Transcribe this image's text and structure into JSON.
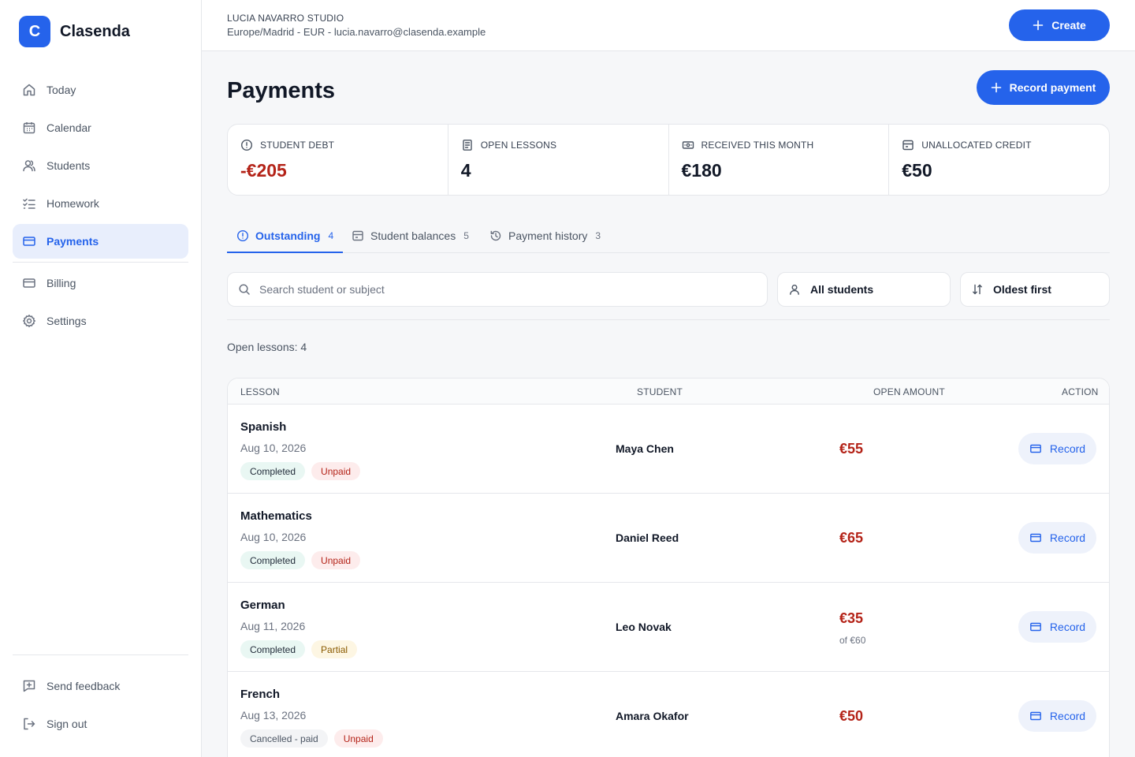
{
  "brand": {
    "logo_letter": "C",
    "name": "Clasenda",
    "accent": "#2563eb"
  },
  "sidebar": {
    "items": [
      {
        "label": "Today",
        "icon": "home-icon"
      },
      {
        "label": "Calendar",
        "icon": "calendar-icon"
      },
      {
        "label": "Students",
        "icon": "users-icon"
      },
      {
        "label": "Homework",
        "icon": "checklist-icon"
      },
      {
        "label": "Payments",
        "icon": "card-icon",
        "active": true
      },
      {
        "label": "Billing",
        "icon": "card-icon"
      },
      {
        "label": "Settings",
        "icon": "gear-icon"
      }
    ],
    "footer": [
      {
        "label": "Send feedback",
        "icon": "feedback-icon"
      },
      {
        "label": "Sign out",
        "icon": "sign-out-icon"
      }
    ]
  },
  "topbar": {
    "studio_name": "LUCIA NAVARRO STUDIO",
    "studio_meta": "Europe/Madrid - EUR - lucia.navarro@clasenda.example",
    "create_label": "Create"
  },
  "page": {
    "title": "Payments",
    "record_payment_label": "Record payment"
  },
  "stats": [
    {
      "label": "STUDENT DEBT",
      "value": "-€205",
      "icon": "alert-circle-icon",
      "negative": true
    },
    {
      "label": "OPEN LESSONS",
      "value": "4",
      "icon": "document-icon"
    },
    {
      "label": "RECEIVED THIS MONTH",
      "value": "€180",
      "icon": "cash-icon"
    },
    {
      "label": "UNALLOCATED CREDIT",
      "value": "€50",
      "icon": "wallet-icon"
    }
  ],
  "tabs": [
    {
      "label": "Outstanding",
      "count": "4",
      "active": true,
      "icon": "alert-circle-icon"
    },
    {
      "label": "Student balances",
      "count": "5",
      "icon": "wallet-icon"
    },
    {
      "label": "Payment history",
      "count": "3",
      "icon": "history-icon"
    }
  ],
  "filters": {
    "search_placeholder": "Search student or subject",
    "student_filter": "All students",
    "sort": "Oldest first"
  },
  "open_lessons_text": "Open lessons: 4",
  "table": {
    "columns": [
      "LESSON",
      "STUDENT",
      "OPEN AMOUNT",
      "ACTION"
    ],
    "rows": [
      {
        "subject": "Spanish",
        "date": "Aug 10, 2026",
        "status": "Completed",
        "payment": "Unpaid",
        "student": "Maya Chen",
        "amount": "€55",
        "amount_note": "",
        "action": "Record"
      },
      {
        "subject": "Mathematics",
        "date": "Aug 10, 2026",
        "status": "Completed",
        "payment": "Unpaid",
        "student": "Daniel Reed",
        "amount": "€65",
        "amount_note": "",
        "action": "Record"
      },
      {
        "subject": "German",
        "date": "Aug 11, 2026",
        "status": "Completed",
        "payment": "Partial",
        "student": "Leo Novak",
        "amount": "€35",
        "amount_note": "of €60",
        "action": "Record"
      },
      {
        "subject": "French",
        "date": "Aug 13, 2026",
        "status": "Cancelled - paid",
        "payment": "Unpaid",
        "student": "Amara Okafor",
        "amount": "€50",
        "amount_note": "",
        "action": "Record"
      }
    ]
  },
  "colors": {
    "accent": "#2563eb",
    "debt": "#b42318",
    "active_nav_bg": "#e8eefc"
  }
}
